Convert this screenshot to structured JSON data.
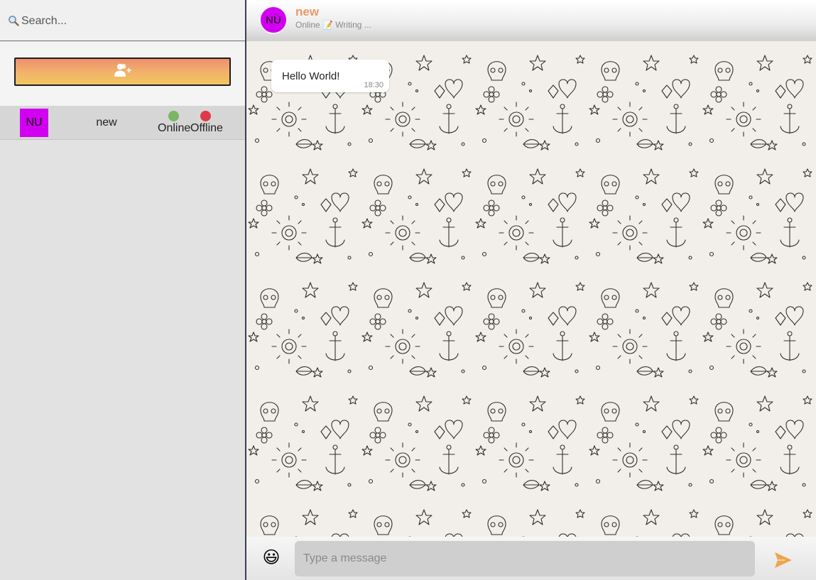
{
  "sidebar": {
    "search": {
      "icon": "search-icon",
      "placeholder": "Search..."
    },
    "add_contact_button": {
      "icon": "add-user-icon",
      "gradient": [
        "#ef8f6f",
        "#f3c462"
      ]
    },
    "contacts": [
      {
        "initials": "NU",
        "name": "new",
        "online_label": "Online",
        "offline_label": "Offline",
        "avatar_color": "#d200f0",
        "online_color": "#7bb662",
        "offline_color": "#e0394a"
      }
    ]
  },
  "chat": {
    "header": {
      "initials": "NU",
      "name": "new",
      "status": "Online 📝 Writing ...",
      "name_color": "#e99a6a"
    },
    "messages": [
      {
        "text": "Hello World!",
        "time": "18:30"
      }
    ],
    "composer": {
      "emoji_icon": "smiley-icon",
      "emoji": "😃",
      "placeholder": "Type a message",
      "send_icon": "send-icon",
      "send_color": "#f0a44c"
    }
  }
}
